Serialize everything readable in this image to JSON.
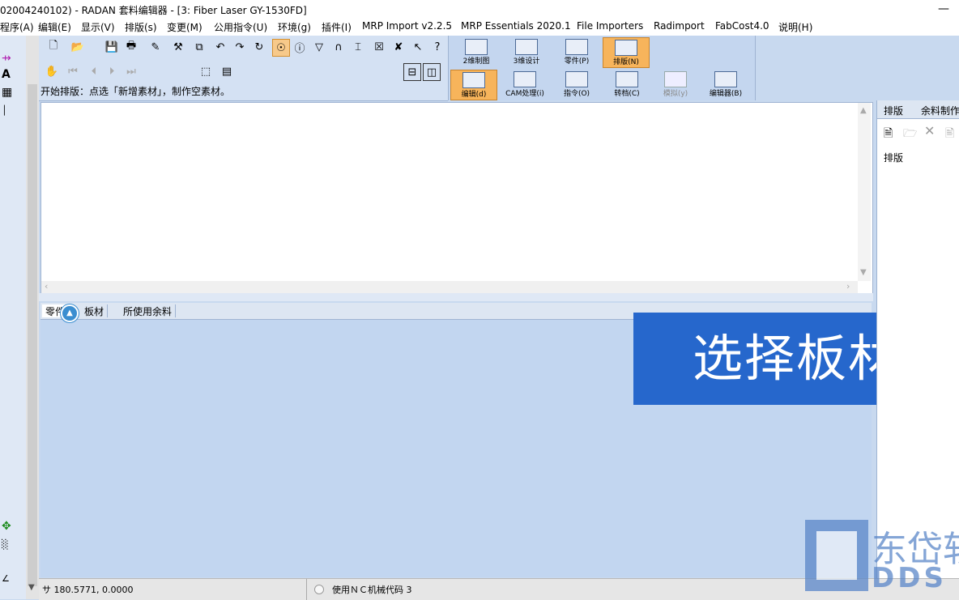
{
  "window": {
    "title": "02004240102) - RADAN 套料编辑器 - [3: Fiber Laser GY-1530FD]",
    "minimize_glyph": "—"
  },
  "menu": [
    "程序(A)",
    "编辑(E)",
    "显示(V)",
    "排版(s)",
    "变更(M)",
    "公用指令(U)",
    "环境(g)",
    "插件(I)",
    "MRP Import v2.2.5",
    "MRP Essentials 2020.1",
    "File Importers",
    "Radimport",
    "FabCost4.0",
    "说明(H)"
  ],
  "toolbar": {
    "row1_icons": [
      "new-icon",
      "open-icon",
      "save-icon",
      "print-icon",
      "pencil-icon",
      "measure-icon",
      "copy-icon",
      "undo-icon",
      "redo-icon",
      "refresh-icon",
      "snap-icon",
      "info-icon",
      "filter-icon",
      "magnet-icon",
      "dimension-icon",
      "export-icon",
      "delete-icon",
      "help-pointer-icon",
      "help-icon"
    ],
    "row2_icons": [
      "hand-icon",
      "first-icon",
      "prev-icon",
      "next-icon",
      "last-icon",
      "sheet-add-icon",
      "grid-icon"
    ],
    "status_text": "开始排版：点选「新增素材」，制作空素材。"
  },
  "modes": {
    "row1": [
      {
        "label": "2维制图",
        "selected": false,
        "disabled": false
      },
      {
        "label": "3维设计",
        "selected": false,
        "disabled": false
      },
      {
        "label": "零件(P)",
        "selected": false,
        "disabled": false
      },
      {
        "label": "排版(N)",
        "selected": true,
        "disabled": false
      }
    ],
    "row2": [
      {
        "label": "编辑(d)",
        "selected": true,
        "disabled": false
      },
      {
        "label": "CAM处理(i)",
        "selected": false,
        "disabled": false
      },
      {
        "label": "指令(O)",
        "selected": false,
        "disabled": false
      },
      {
        "label": "转档(C)",
        "selected": false,
        "disabled": false
      },
      {
        "label": "模拟(y)",
        "selected": false,
        "disabled": true
      },
      {
        "label": "编辑器(B)",
        "selected": false,
        "disabled": false
      }
    ]
  },
  "lower_tabs": [
    {
      "label": "零件",
      "active": true
    },
    {
      "label": "板材",
      "active": false
    },
    {
      "label": "所使用余料",
      "active": false
    }
  ],
  "banner": {
    "text": "选择板材",
    "color": "#2667cc"
  },
  "right_panel": {
    "tabs": [
      "排版",
      "余料制作"
    ],
    "tools": [
      "new-nest-icon",
      "open-folder-icon",
      "close-icon",
      "properties-icon"
    ],
    "item": "排版"
  },
  "statusbar": {
    "coord": "180.5771, 0.0000",
    "nc": "使用ＮＣ机械代码 3"
  },
  "watermark": {
    "cn": "东岱软",
    "en": "DDS"
  },
  "colors": {
    "accent": "#f7b45b",
    "background": "#c2d6f0"
  }
}
